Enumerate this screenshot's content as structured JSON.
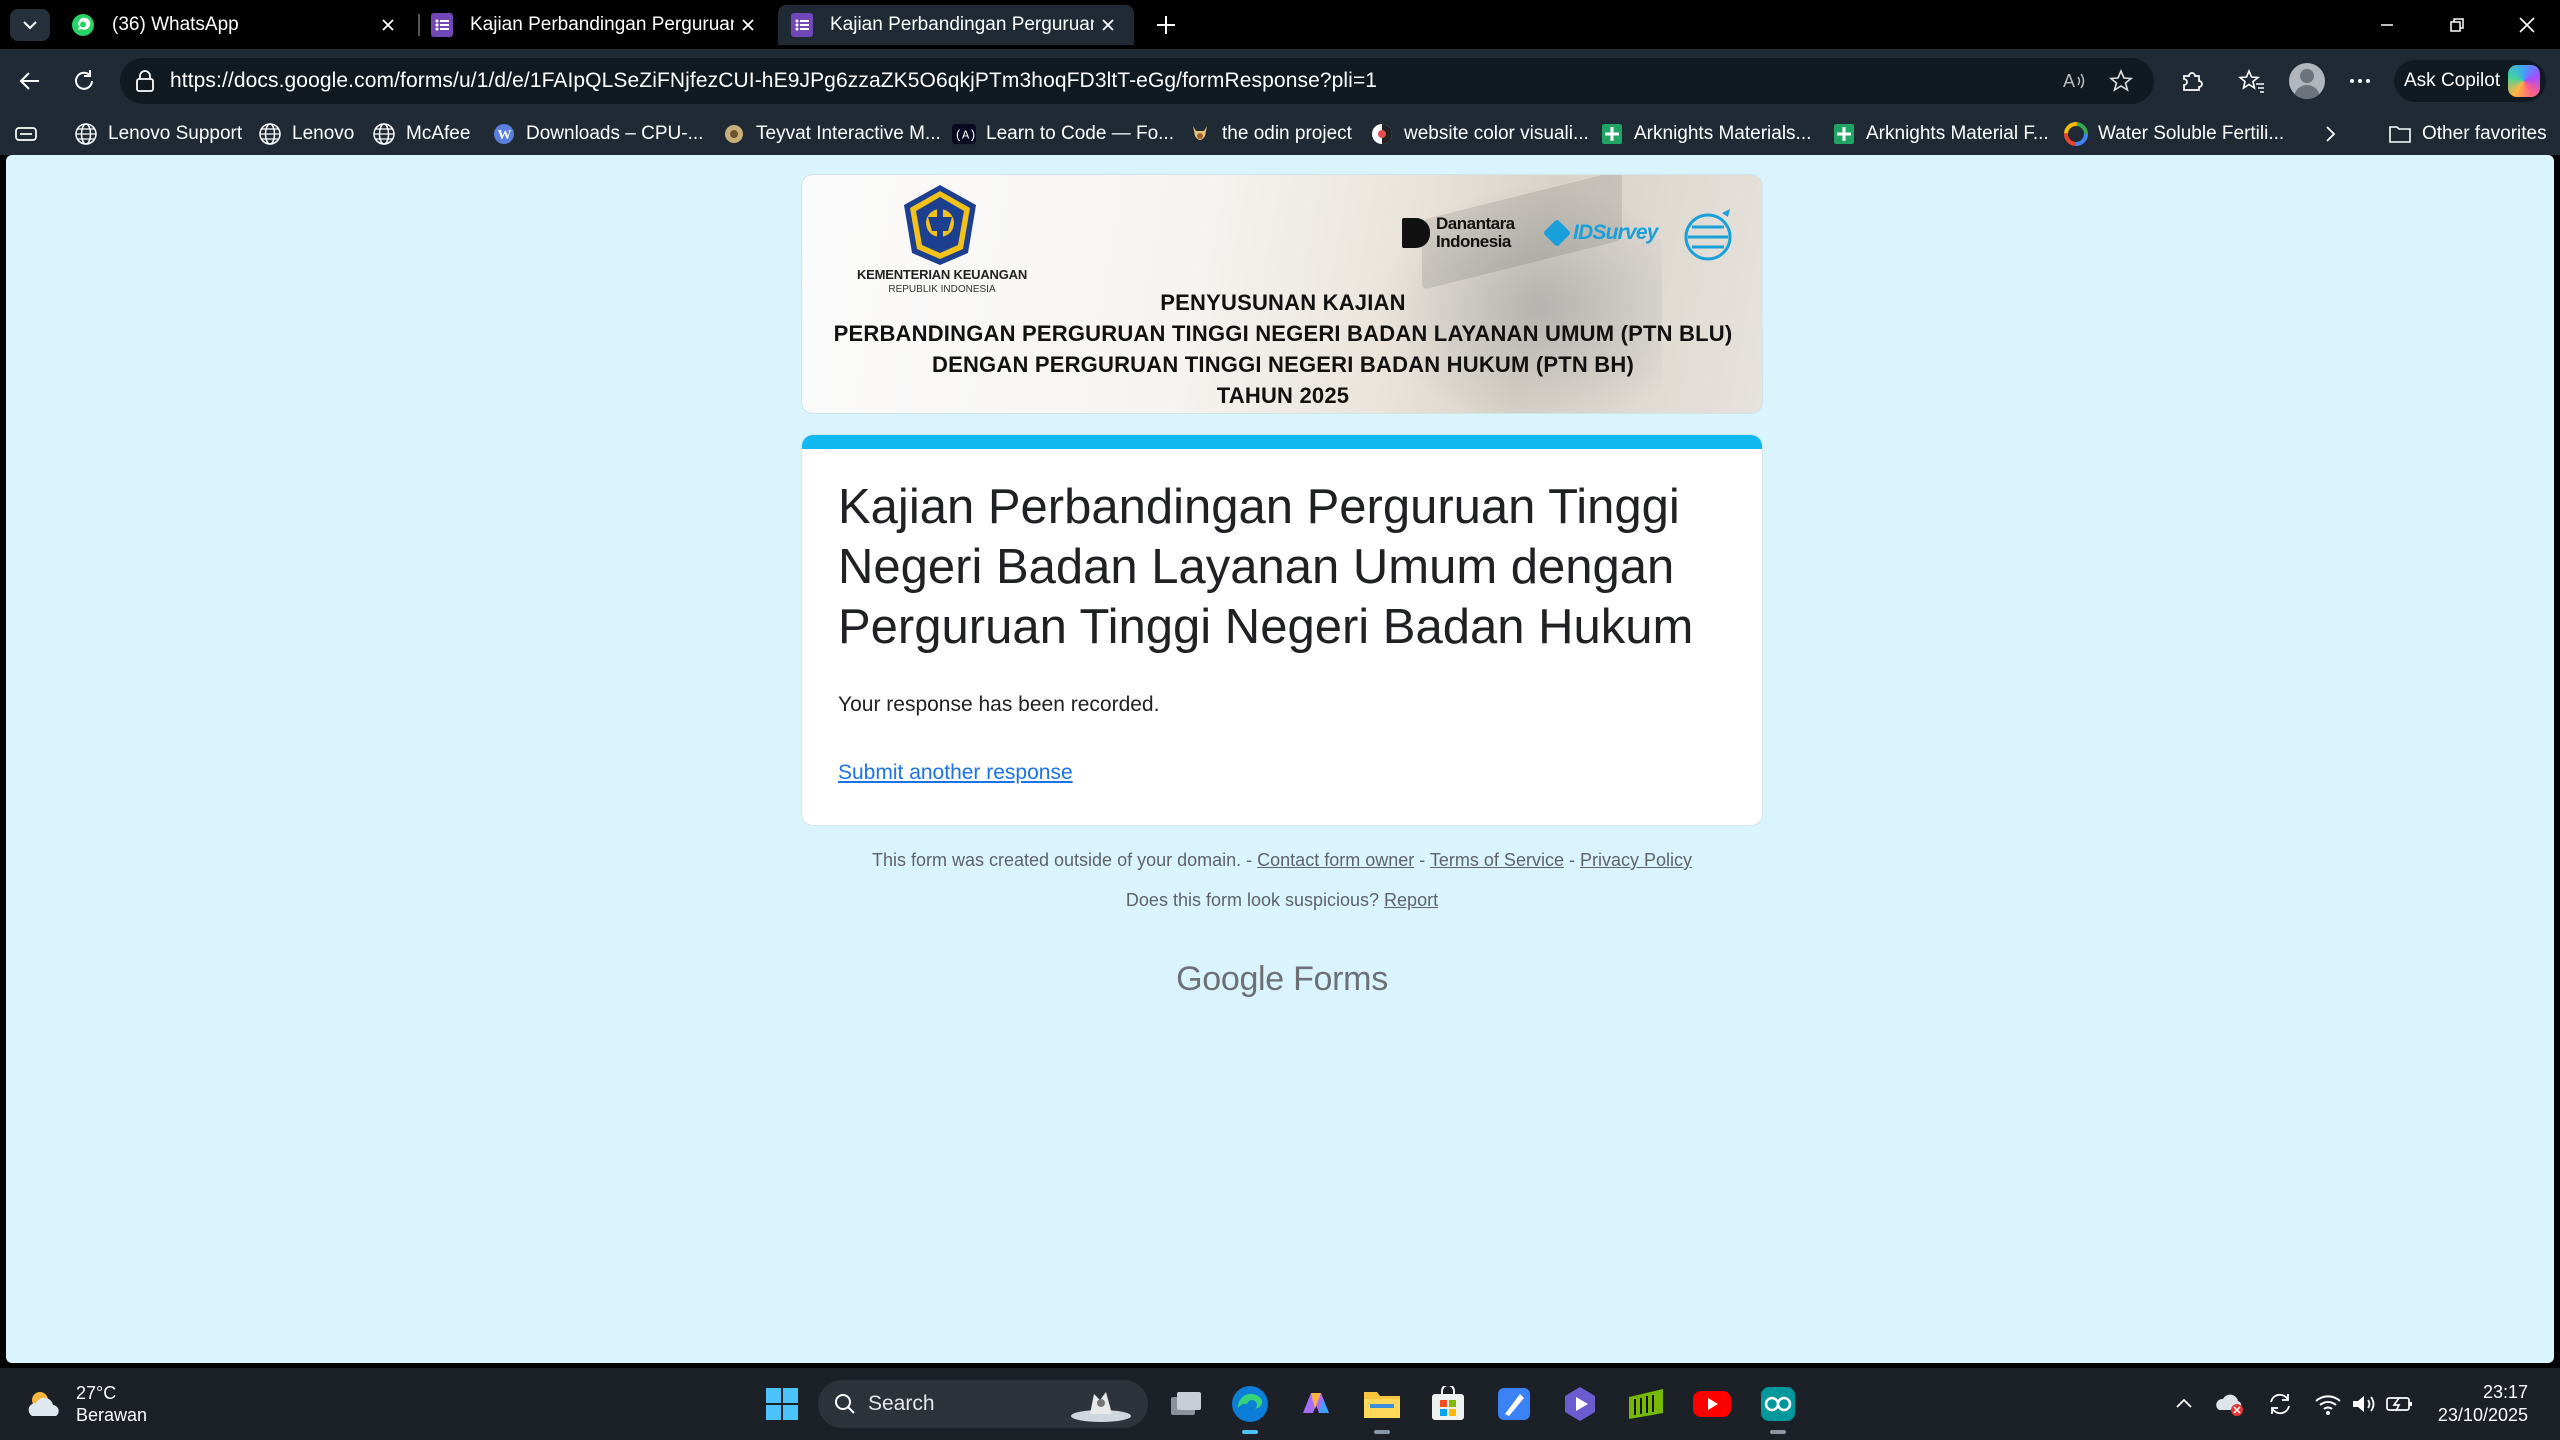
{
  "browser": {
    "tabs": [
      {
        "label": "(36) WhatsApp",
        "icon": "whatsapp-icon"
      },
      {
        "label": "Kajian Perbandingan Perguruan T",
        "icon": "google-forms-icon"
      },
      {
        "label": "Kajian Perbandingan Perguruan T",
        "icon": "google-forms-icon"
      }
    ],
    "url": "https://docs.google.com/forms/u/1/d/e/1FAIpQLSeZiFNjfezCUI-hE9JPg6zzaZK5O6qkjPTm3hoqFD3ltT-eGg/formResponse?pli=1",
    "copilot_label": "Ask Copilot",
    "favorites": [
      {
        "label": "Lenovo Support"
      },
      {
        "label": "Lenovo"
      },
      {
        "label": "McAfee"
      },
      {
        "label": "Downloads – CPU-..."
      },
      {
        "label": "Teyvat Interactive M..."
      },
      {
        "label": "Learn to Code — Fo..."
      },
      {
        "label": "the odin project"
      },
      {
        "label": "website color visuali..."
      },
      {
        "label": "Arknights Materials..."
      },
      {
        "label": "Arknights Material F..."
      },
      {
        "label": "Water Soluble Fertili..."
      }
    ],
    "other_favorites": "Other favorites"
  },
  "banner": {
    "ministry_name": "KEMENTERIAN KEUANGAN",
    "ministry_sub": "REPUBLIK INDONESIA",
    "partner1": "Danantara Indonesia",
    "partner1_line1": "Danantara",
    "partner1_line2": "Indonesia",
    "partner2": "IDSurvey",
    "line1": "PENYUSUNAN KAJIAN",
    "line2": "PERBANDINGAN PERGURUAN TINGGI NEGERI BADAN LAYANAN UMUM (PTN BLU)",
    "line3": "DENGAN PERGURUAN TINGGI NEGERI BADAN HUKUM (PTN BH)",
    "line4": "TAHUN 2025"
  },
  "form": {
    "title": "Kajian Perbandingan Perguruan Tinggi Negeri Badan Layanan Umum dengan Perguruan Tinggi Negeri Badan Hukum",
    "message": "Your response has been recorded.",
    "link": "Submit another response",
    "accent_color": "#12b8f0"
  },
  "footer": {
    "created_text": "This form was created outside of your domain. -",
    "contact": "Contact form owner",
    "sep": "-",
    "terms": "Terms of Service",
    "privacy": "Privacy Policy",
    "suspicious": "Does this form look suspicious?",
    "report": "Report",
    "brand_google": "Google",
    "brand_forms": "Forms"
  },
  "taskbar": {
    "weather_temp": "27°C",
    "weather_desc": "Berawan",
    "search_label": "Search",
    "time": "23:17",
    "date": "23/10/2025"
  }
}
